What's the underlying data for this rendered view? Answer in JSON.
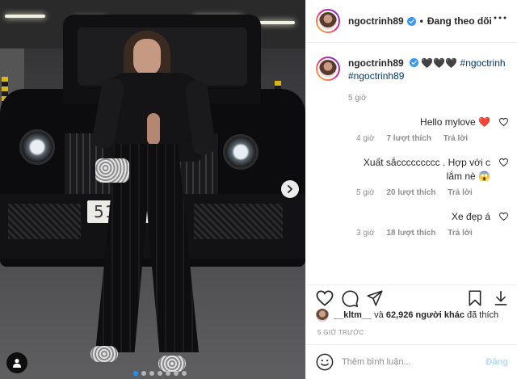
{
  "photo": {
    "plate_text": "51...0",
    "carousel_dots": 7,
    "active_dot": 0
  },
  "header": {
    "username": "ngoctrinh89",
    "separator": "•",
    "follow_label": "Đang theo dõi"
  },
  "caption": {
    "username": "ngoctrinh89",
    "hearts": "🖤🖤🖤",
    "hashtag1": "#ngoctrinh",
    "hashtag2": "#ngoctrinh89",
    "time": "5 giờ"
  },
  "comments": [
    {
      "text": "Hello mylove ❤️",
      "time": "4 giờ",
      "likes": "7 lượt thích",
      "reply": "Trả lời"
    },
    {
      "text": "Xuất sắccccccccc . Hợp với c lắm nè 😱",
      "time": "5 giờ",
      "likes": "20 lượt thích",
      "reply": "Trả lời"
    },
    {
      "text": "Xe đẹp á",
      "time": "3 giờ",
      "likes": "18 lượt thích",
      "reply": "Trả lời"
    }
  ],
  "likes_bar": {
    "user": "__kltm__",
    "connector": "và",
    "count_text": "62,926 người khác",
    "suffix": "đã thích"
  },
  "time_ago": "5 GIỜ TRƯỚC",
  "add_comment": {
    "placeholder": "Thêm bình luận...",
    "post_label": "Đăng"
  },
  "colors": {
    "verified": "#3897f0",
    "hashtag": "#00376b",
    "heart": "#ed4956",
    "post_disabled": "#b3dbff"
  }
}
